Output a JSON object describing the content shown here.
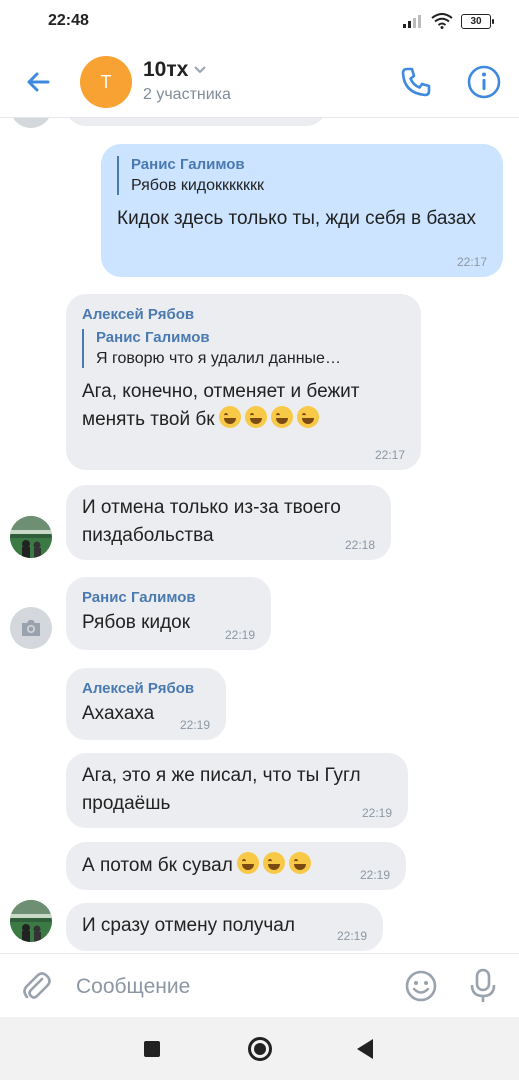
{
  "status_bar": {
    "time": "22:48",
    "battery": "30"
  },
  "header": {
    "avatar_letter": "T",
    "title": "10тх",
    "subtitle": "2 участника"
  },
  "messages": [
    {
      "direction": "out",
      "reply_name": "Ранис Галимов",
      "reply_text": "Рябов кидоккккккк",
      "text": "Кидок здесь только ты, жди себя в базах",
      "time": "22:17"
    },
    {
      "direction": "in",
      "sender": "Алексей Рябов",
      "reply_name": "Ранис Галимов",
      "reply_text": "Я говорю что я удалил данные…",
      "text": "Ага, конечно, отменяет и бежит менять твой бк",
      "emoji_count": 4,
      "emoji": "rolling-laughing",
      "time": "22:17"
    },
    {
      "direction": "in",
      "text": "И отмена только из-за твоего пиздабольства",
      "time": "22:18"
    },
    {
      "direction": "in",
      "sender": "Ранис Галимов",
      "text": "Рябов кидок",
      "time": "22:19"
    },
    {
      "direction": "in",
      "sender": "Алексей Рябов",
      "text": "Ахахаха",
      "time": "22:19"
    },
    {
      "direction": "in",
      "text": "Ага, это я же писал, что ты Гугл продаёшь",
      "time": "22:19"
    },
    {
      "direction": "in",
      "text": "А потом бк сувал",
      "emoji_count": 3,
      "emoji": "tears-of-joy",
      "time": "22:19"
    },
    {
      "direction": "in",
      "text": "И сразу отмену получал",
      "time": "22:19"
    }
  ],
  "composer": {
    "placeholder": "Сообщение"
  },
  "colors": {
    "accent": "#3f8ae0",
    "incoming_bubble": "#ebedf0",
    "outgoing_bubble": "#cce4ff",
    "avatar_orange": "#f7a232"
  }
}
